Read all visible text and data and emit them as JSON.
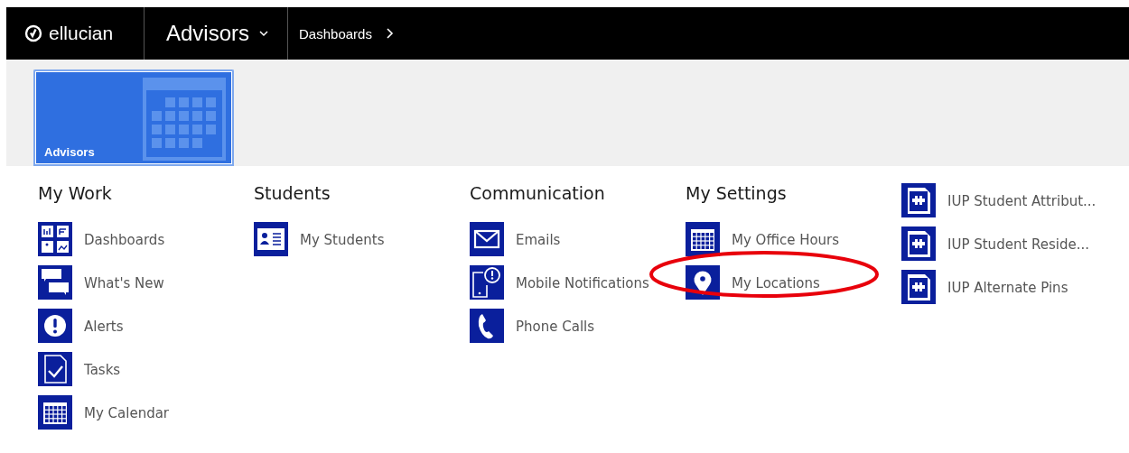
{
  "top_bar": {
    "brand": "ellucian",
    "workspace": "Advisors",
    "breadcrumb": "Dashboards"
  },
  "tiles": [
    {
      "label": "Advisors",
      "selected": true
    }
  ],
  "columns": [
    {
      "heading": "My Work",
      "items": [
        {
          "label": "Dashboards",
          "kind": "dashboards",
          "highlighted": false
        },
        {
          "label": "What's New",
          "kind": "chat",
          "highlighted": false
        },
        {
          "label": "Alerts",
          "kind": "alert",
          "highlighted": false
        },
        {
          "label": "Tasks",
          "kind": "task",
          "highlighted": false
        },
        {
          "label": "My Calendar",
          "kind": "calendar",
          "highlighted": false
        }
      ]
    },
    {
      "heading": "Students",
      "items": [
        {
          "label": "My Students",
          "kind": "students",
          "highlighted": false
        }
      ]
    },
    {
      "heading": "Communication",
      "items": [
        {
          "label": "Emails",
          "kind": "mail",
          "highlighted": false
        },
        {
          "label": "Mobile Notifications",
          "kind": "mobile",
          "highlighted": false
        },
        {
          "label": "Phone Calls",
          "kind": "phone",
          "highlighted": false
        }
      ]
    },
    {
      "heading": "My Settings",
      "items": [
        {
          "label": "My Office Hours",
          "kind": "calendar",
          "highlighted": false
        },
        {
          "label": "My Locations",
          "kind": "pin",
          "highlighted": true
        }
      ]
    },
    {
      "items": [
        {
          "label": "IUP Student Attribut...",
          "kind": "puzzle",
          "highlighted": false
        },
        {
          "label": "IUP Student Reside...",
          "kind": "puzzle",
          "highlighted": false
        },
        {
          "label": "IUP Alternate Pins",
          "kind": "puzzle",
          "highlighted": false
        }
      ]
    }
  ]
}
